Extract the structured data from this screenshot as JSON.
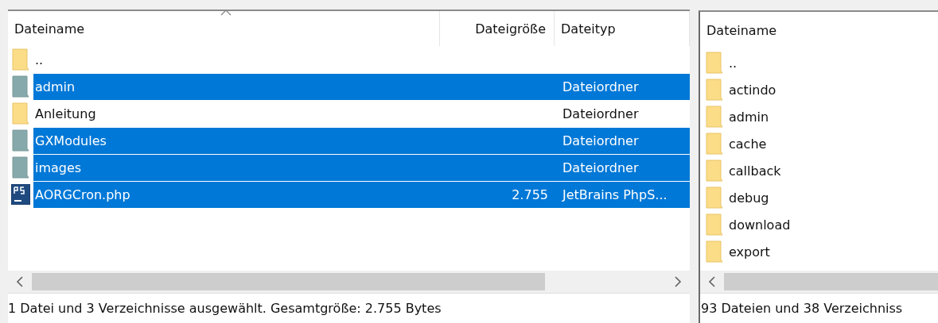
{
  "left_pane": {
    "columns": [
      "Dateiname",
      "Dateigröße",
      "Dateityp"
    ],
    "rows": [
      {
        "name": "..",
        "size": "",
        "type": "",
        "kind": "folder",
        "selected": false
      },
      {
        "name": "admin",
        "type": "Dateiordner",
        "kind": "folder",
        "selected": true
      },
      {
        "name": "Anleitung",
        "type": "Dateiordner",
        "kind": "folder",
        "selected": false
      },
      {
        "name": "GXModules",
        "type": "Dateiordner",
        "kind": "folder",
        "selected": true
      },
      {
        "name": "images",
        "type": "Dateiordner",
        "kind": "folder",
        "selected": true
      },
      {
        "name": "AORGCron.php",
        "size": "2.755",
        "type": "JetBrains PhpS...",
        "kind": "php-file",
        "selected": true
      }
    ],
    "status_bar": "1 Datei und 3 Verzeichnisse ausgewählt. Gesamtgröße: 2.755 Bytes"
  },
  "right_pane": {
    "columns": [
      "Dateiname"
    ],
    "rows": [
      {
        "name": "..",
        "kind": "folder",
        "selected": false
      },
      {
        "name": "actindo",
        "kind": "folder",
        "selected": false
      },
      {
        "name": "admin",
        "kind": "folder",
        "selected": false
      },
      {
        "name": "cache",
        "kind": "folder",
        "selected": false
      },
      {
        "name": "callback",
        "kind": "folder",
        "selected": false
      },
      {
        "name": "debug",
        "kind": "folder",
        "selected": false
      },
      {
        "name": "download",
        "kind": "folder",
        "selected": false
      },
      {
        "name": "export",
        "kind": "folder",
        "selected": false
      }
    ],
    "status_bar": "93 Dateien und 38 Verzeichniss"
  }
}
